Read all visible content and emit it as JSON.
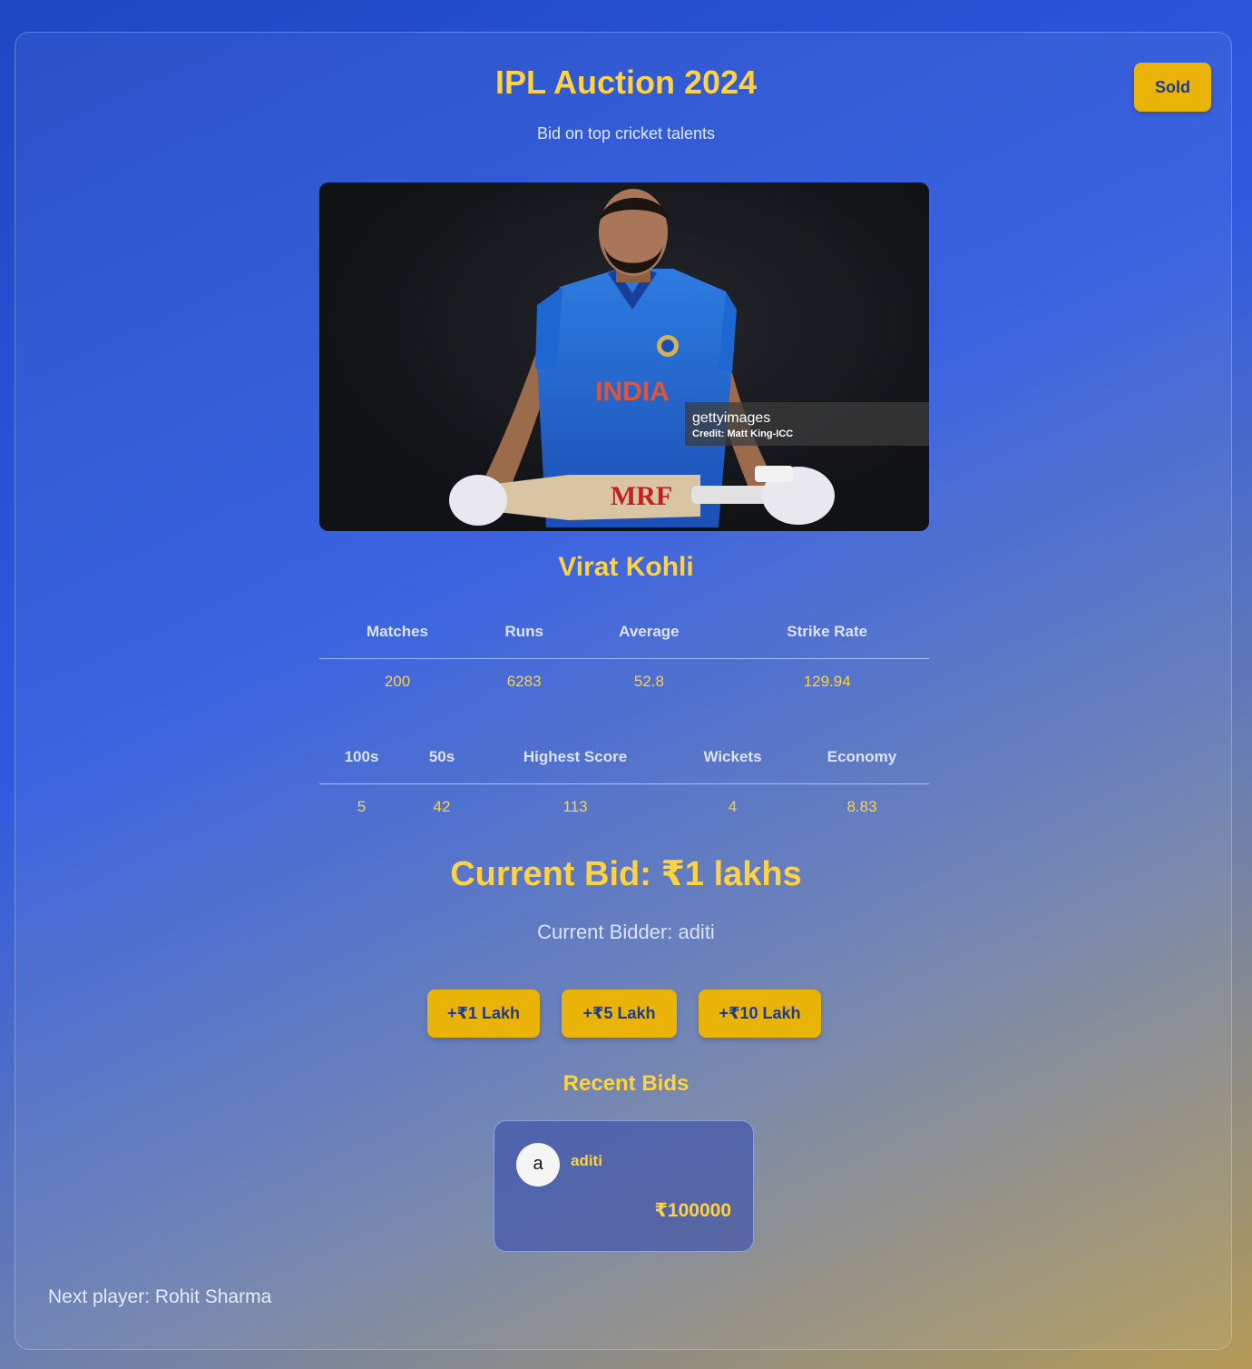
{
  "header": {
    "title": "IPL Auction 2024",
    "subtitle": "Bid on top cricket talents",
    "sold_label": "Sold"
  },
  "player": {
    "name": "Virat Kohli",
    "photo_watermark": "gettyimages",
    "photo_credit": "Credit: Matt King-ICC"
  },
  "stats_primary": {
    "headers": [
      "Matches",
      "Runs",
      "Average",
      "Strike Rate"
    ],
    "values": [
      "200",
      "6283",
      "52.8",
      "129.94"
    ]
  },
  "stats_secondary": {
    "headers": [
      "100s",
      "50s",
      "Highest Score",
      "Wickets",
      "Economy"
    ],
    "values": [
      "5",
      "42",
      "113",
      "4",
      "8.83"
    ]
  },
  "bidding": {
    "current_bid": "Current Bid: ₹1 lakhs",
    "current_bidder": "Current Bidder: aditi",
    "increments": [
      "+₹1 Lakh",
      "+₹5 Lakh",
      "+₹10 Lakh"
    ]
  },
  "recent_bids": {
    "title": "Recent Bids",
    "items": [
      {
        "avatar_letter": "a",
        "user": "aditi",
        "amount": "₹100000"
      }
    ]
  },
  "footer": {
    "next_player": "Next player: Rohit Sharma"
  },
  "colors": {
    "accent": "#ffd23f",
    "button": "#eab308",
    "button_text": "#1e3a8a"
  }
}
